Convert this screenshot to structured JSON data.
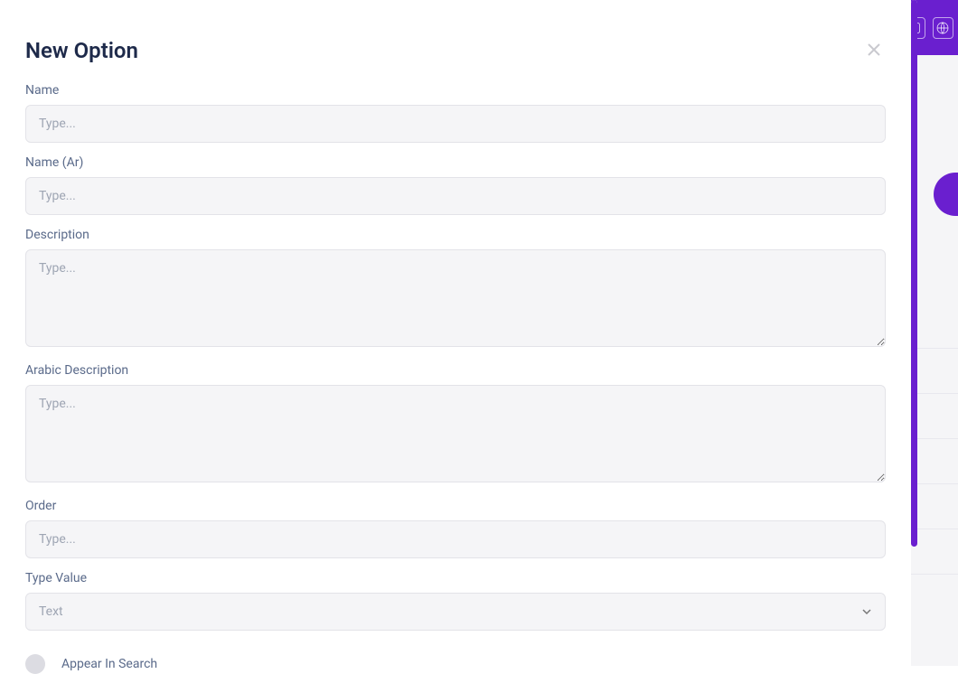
{
  "modal": {
    "title": "New Option",
    "fields": {
      "name": {
        "label": "Name",
        "placeholder": "Type...",
        "value": ""
      },
      "name_ar": {
        "label": "Name (Ar)",
        "placeholder": "Type...",
        "value": ""
      },
      "description": {
        "label": "Description",
        "placeholder": "Type...",
        "value": ""
      },
      "arabic_description": {
        "label": "Arabic Description",
        "placeholder": "Type...",
        "value": ""
      },
      "order": {
        "label": "Order",
        "placeholder": "Type...",
        "value": ""
      },
      "type_value": {
        "label": "Type Value",
        "selected": "Text"
      },
      "appear_in_search": {
        "label": "Appear In Search",
        "checked": false
      }
    }
  }
}
